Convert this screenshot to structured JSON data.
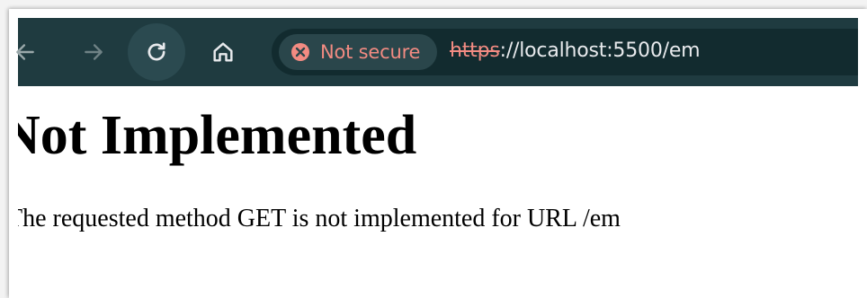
{
  "browser": {
    "security_label": "Not secure",
    "url_scheme": "https",
    "url_rest": "://localhost:5500/em",
    "toolbar_color": "#1f3b40",
    "warning_color": "#f28b82",
    "icons": {
      "back": "arrow-left-icon",
      "forward": "arrow-right-icon",
      "reload": "reload-icon",
      "home": "home-icon",
      "security": "error-circle-icon"
    }
  },
  "page": {
    "heading": "Not Implemented",
    "message": "The requested method GET is not implemented for URL /em"
  }
}
